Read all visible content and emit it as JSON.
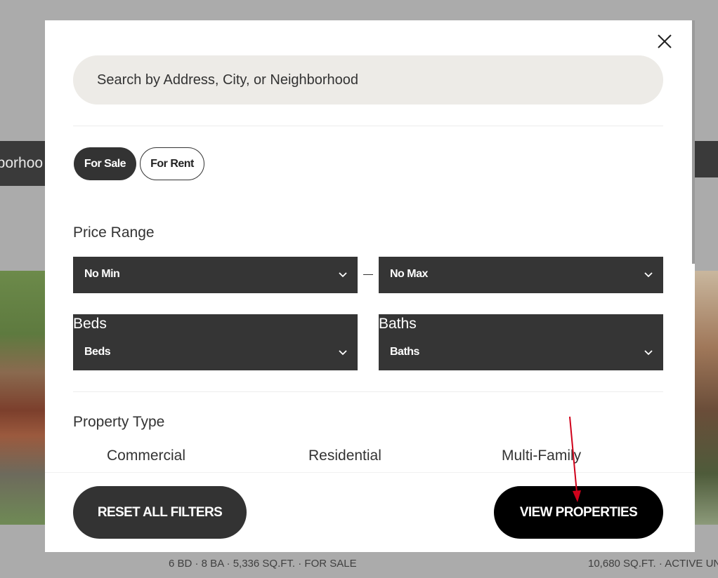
{
  "background": {
    "nav_fragment": "nborhoo",
    "caption_left": "6 BD · 8 BA · 5,336 SQ.FT. · FOR SALE",
    "caption_right": "10,680 SQ.FT. · ACTIVE UN"
  },
  "modal": {
    "search": {
      "placeholder": "Search by Address, City, or Neighborhood",
      "value": ""
    },
    "listing_toggle": {
      "for_sale": "For Sale",
      "for_rent": "For Rent",
      "selected": "For Sale"
    },
    "price_range": {
      "label": "Price Range",
      "min": "No Min",
      "max": "No Max"
    },
    "beds": {
      "label": "Beds",
      "value": "Beds"
    },
    "baths": {
      "label": "Baths",
      "value": "Baths"
    },
    "property_type": {
      "label": "Property Type",
      "options": [
        "Commercial",
        "Residential",
        "Multi-Family"
      ]
    },
    "footer": {
      "reset_label": "RESET ALL FILTERS",
      "view_label": "VIEW PROPERTIES"
    }
  },
  "colors": {
    "overlay": "#ababab",
    "dark": "#333333",
    "search_bg": "#edebe7",
    "primary_button": "#000000",
    "annotation_arrow": "#d0021b"
  },
  "icons": {
    "close": "close-icon",
    "dropdown": "chevron-down-icon"
  }
}
